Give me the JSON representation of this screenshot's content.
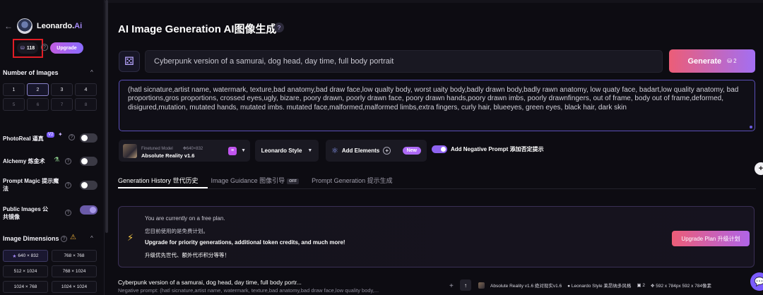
{
  "brand": {
    "back_icon": "←",
    "name": "Leonardo.",
    "name_suffix": "Ai"
  },
  "tokens": {
    "count": "118",
    "help": "?",
    "upgrade_label": "Upgrade"
  },
  "sidebar": {
    "num_images_title": "Number of Images",
    "num_images": [
      "1",
      "2",
      "3",
      "4",
      "5",
      "6",
      "7",
      "8"
    ],
    "photoreal_label": "PhotoReal 逼真",
    "photoreal_badge": "V2",
    "alchemy_label": "Alchemy 炼金术",
    "prompt_magic_label": "Prompt Magic 提示魔法",
    "public_images_label": "Public Images 公共镜像",
    "image_dimensions_title": "Image Dimensions",
    "dimensions": [
      "640 × 832",
      "768 × 768",
      "512 × 1024",
      "768 × 1024",
      "1024 × 768",
      "1024 × 1024"
    ]
  },
  "main": {
    "title": "AI Image Generation  AI图像生成",
    "prompt_text": "Cyberpunk version of a samurai, dog head, day time, full body portrait",
    "generate_label": "Generate",
    "generate_cost": "2",
    "negative_prompt": "(hatl sicnature,artist name, watermark, texture,bad anatomy,bad draw face,low qualty body, worst uaity body,badly drawn body,badly rawn anatomy, low quaty face, badart,low quality anatomy, bad proportions,gros proportions, crossed eyes,ugly, bizare, poory drawn, poorly drawn face, poory drawn hands,poory drawn imbs, poorly drawnfingers, out of frame, body out of frame,deformed, disigured,mutation, mutated hands, mutated imbs. mutated face,malformed,malformed limbs,extra fingers, curly hair, blueeyes, green eyes, black hair, dark skin",
    "model_tag": "Finetuned Model",
    "model_size": "640×832",
    "model_name": "Absolute Reality v1.6",
    "style_label": "Leonardo Style",
    "add_elements_label": "Add Elements",
    "new_badge": "New",
    "add_negative_label": "Add Negative Prompt 添加否定提示"
  },
  "tabs": [
    {
      "label": "Generation History  世代历史"
    },
    {
      "label": "Image Guidance 图像引导",
      "badge": "OFF"
    },
    {
      "label": "Prompt Generation  提示生成"
    }
  ],
  "banner": {
    "line1": "You are currently on a free plan.",
    "line2": "您目前使用的是免费计划。",
    "line3": "Upgrade for priority generations, additional token credits, and much more!",
    "line4": "升级优先世代、额外代币积分等等！",
    "button": "Upgrade Plan 升级计划"
  },
  "history": {
    "title": "Cyberpunk version of a samurai, dog head, day time, full body portr...",
    "negative": "Negative prompt: (hatl sicnature,artist name, watermark, texture,bad anatomy,bad draw face,low quality body,...",
    "model": "Absolute Reality v1.6 绝对现实v1.6",
    "style": "Leonardo Style 莱昂纳多风格",
    "count": "2",
    "dims": "592 x 784px 592 x 784像素"
  }
}
